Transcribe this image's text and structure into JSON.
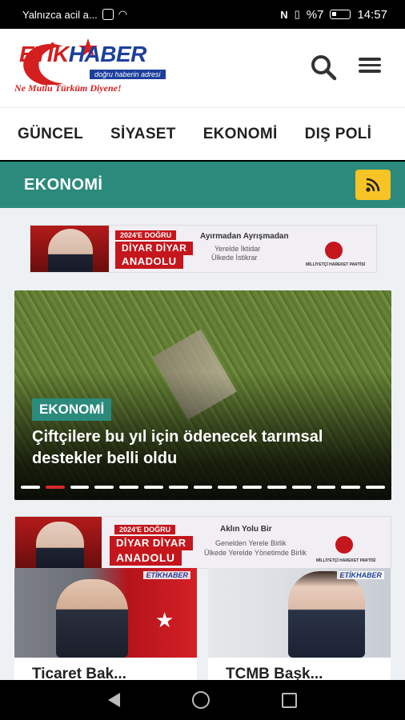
{
  "status_bar": {
    "notification": "Yalnızca acil a...",
    "battery": "%7",
    "time": "14:57"
  },
  "header": {
    "logo_etik": "ETİK",
    "logo_haber": "HABER",
    "logo_tagline": "doğru haberin adresi",
    "logo_slogan": "Ne Mutlu Türküm Diyene!",
    "icons": [
      "search-icon",
      "menu-icon"
    ]
  },
  "categories": [
    "GÜNCEL",
    "SİYASET",
    "EKONOMİ",
    "DIŞ POLİ"
  ],
  "section": {
    "title": "EKONOMİ",
    "rss_icon": "rss-icon"
  },
  "banner_top": {
    "year_badge": "2024'E DOĞRU",
    "headline_1": "DİYAR DİYAR",
    "headline_2": "ANADOLU",
    "line_1": "Ayırmadan Ayrışmadan",
    "line_2": "Yerelde İktidar",
    "line_3": "Ülkede İstikrar",
    "party": "MİLLİYETÇİ HAREKET PARTİSİ"
  },
  "featured": {
    "tag": "EKONOMİ",
    "title": "Çiftçilere bu yıl için ödenecek tarımsal destekler belli oldu",
    "slides_total": 15,
    "active_slide": 2
  },
  "banner_second": {
    "year_badge": "2024'E DOĞRU",
    "headline_1": "DİYAR DİYAR",
    "headline_2": "ANADOLU",
    "line_1": "Aklın Yolu Bir",
    "line_2": "Geneldеn Yerele Birlik",
    "line_3": "Ülkede Yerelde Yönetimde Birlik",
    "party": "MİLLİYETÇİ HAREKET PARTİSİ"
  },
  "cards": [
    {
      "title": "Ticaret Bak...",
      "logo": "ETİKHABER"
    },
    {
      "title": "TCMB Bașk...",
      "logo": "ETİKHABER"
    }
  ],
  "colors": {
    "accent_teal": "#2b8a7c",
    "rss_yellow": "#f7c325",
    "brand_blue": "#1d3f9c",
    "brand_red": "#d41f1f"
  }
}
